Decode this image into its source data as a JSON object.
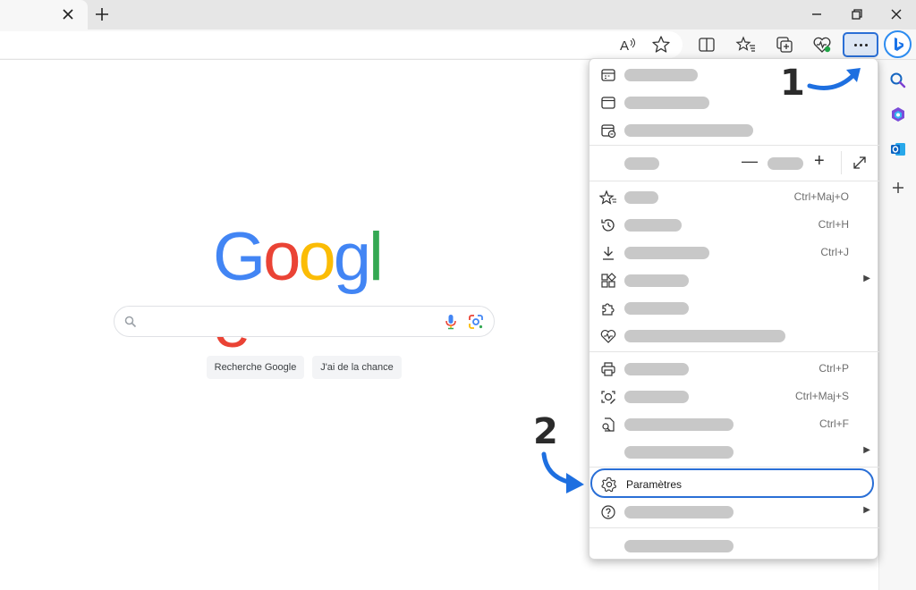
{
  "browser": {
    "tab_close_icon": "close-icon",
    "new_tab_icon": "plus-icon",
    "window_controls": [
      "minimize-icon",
      "restore-icon",
      "close-icon"
    ],
    "toolbar_icons": [
      "read-aloud-icon",
      "favorite-star-icon",
      "split-screen-icon",
      "favorites-list-icon",
      "collections-icon",
      "browser-essentials-icon"
    ],
    "more_icon": "more-dots-icon",
    "bing_icon": "bing-copilot-icon",
    "accent_color": "#2a6fd6"
  },
  "sidebar": {
    "icons": [
      "search-icon",
      "office-icon",
      "outlook-icon",
      "add-icon"
    ]
  },
  "google": {
    "logo_letters": [
      "G",
      "o",
      "o",
      "g",
      "l",
      "e"
    ],
    "logo_colors": [
      "#4285F4",
      "#EA4335",
      "#FBBC05",
      "#4285F4",
      "#34A853",
      "#EA4335"
    ],
    "search_button": "Recherche Google",
    "lucky_button": "J'ai de la chance"
  },
  "menu": {
    "rows_top": [
      {
        "icon": "new-tab-icon"
      },
      {
        "icon": "new-window-icon"
      },
      {
        "icon": "inprivate-window-icon"
      }
    ],
    "zoom": {
      "minus": "—",
      "plus": "+",
      "expand_icon": "fullscreen-icon"
    },
    "rows_mid": [
      {
        "icon": "favorites-icon",
        "shortcut": "Ctrl+Maj+O"
      },
      {
        "icon": "history-icon",
        "shortcut": "Ctrl+H"
      },
      {
        "icon": "downloads-icon",
        "shortcut": "Ctrl+J"
      },
      {
        "icon": "apps-icon",
        "submenu": "▶"
      },
      {
        "icon": "extensions-icon"
      },
      {
        "icon": "browser-essentials-icon"
      }
    ],
    "rows_tools": [
      {
        "icon": "print-icon",
        "shortcut": "Ctrl+P"
      },
      {
        "icon": "screenshot-icon",
        "shortcut": "Ctrl+Maj+S"
      },
      {
        "icon": "find-on-page-icon",
        "shortcut": "Ctrl+F"
      },
      {
        "icon": "",
        "submenu": "▶"
      }
    ],
    "settings_label": "Paramètres",
    "settings_icon": "gear-icon",
    "help": {
      "icon": "help-icon",
      "submenu": "▶"
    }
  },
  "annotations": {
    "step1": "1",
    "step2": "2",
    "arrow_color": "#1e6fe0"
  }
}
